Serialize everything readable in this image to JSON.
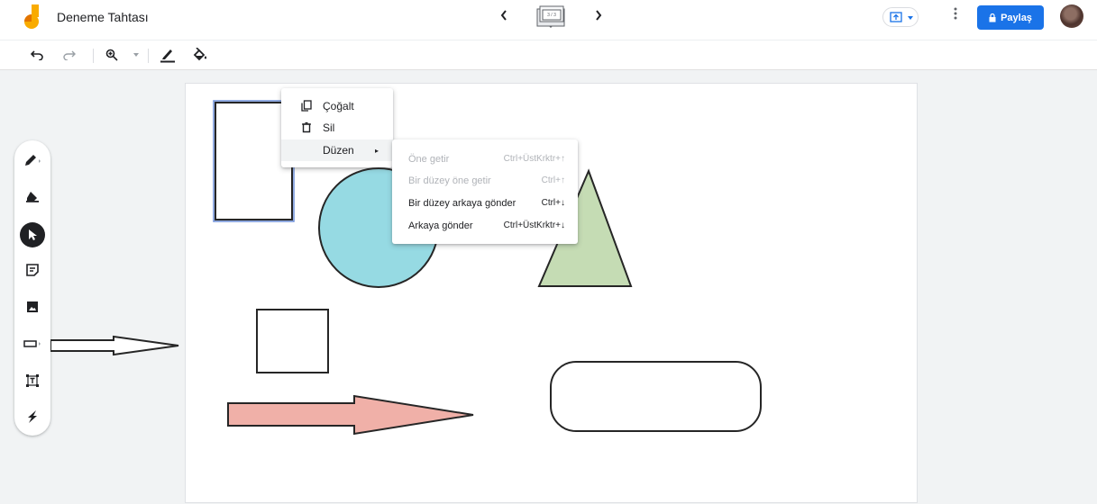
{
  "app": {
    "title": "Deneme Tahtası",
    "frame_counter": "3 / 3",
    "share_label": "Paylaş",
    "accent_color": "#1a73e8"
  },
  "icons": {
    "logo": "jamboard-logo-icon",
    "prev": "chevron-left-icon",
    "next": "chevron-right-icon",
    "present": "present-icon",
    "more": "more-vert-icon",
    "lock": "lock-icon",
    "undo": "undo-icon",
    "redo": "redo-icon",
    "zoom": "zoom-in-icon",
    "pen_color": "pen-color-icon",
    "fill": "fill-bucket-icon"
  },
  "side_tools": [
    {
      "name": "pen-tool",
      "icon": "pen-icon"
    },
    {
      "name": "eraser-tool",
      "icon": "eraser-icon"
    },
    {
      "name": "select-tool",
      "icon": "cursor-icon",
      "active": true
    },
    {
      "name": "sticky-note-tool",
      "icon": "sticky-note-icon"
    },
    {
      "name": "image-tool",
      "icon": "image-icon"
    },
    {
      "name": "shape-tool",
      "icon": "rectangle-icon"
    },
    {
      "name": "text-box-tool",
      "icon": "text-box-icon"
    },
    {
      "name": "laser-tool",
      "icon": "laser-icon"
    }
  ],
  "context_menu": {
    "items": [
      {
        "label": "Çoğalt",
        "icon": "duplicate-icon"
      },
      {
        "label": "Sil",
        "icon": "delete-icon"
      },
      {
        "label": "Düzen",
        "submenu_arrow": "▸"
      }
    ]
  },
  "arrange_submenu": {
    "items": [
      {
        "label": "Öne getir",
        "shortcut": "Ctrl+ÜstKrktr+↑",
        "enabled": false
      },
      {
        "label": "Bir düzey öne getir",
        "shortcut": "Ctrl+↑",
        "enabled": false
      },
      {
        "label": "Bir düzey arkaya gönder",
        "shortcut": "Ctrl+↓",
        "enabled": true
      },
      {
        "label": "Arkaya gönder",
        "shortcut": "Ctrl+ÜstKrktr+↓",
        "enabled": true
      }
    ]
  },
  "canvas_shapes": {
    "circle_fill": "#96dae3",
    "triangle_fill": "#c5dcb4",
    "arrow_fill": "#f0b0a8",
    "stroke": "#262626",
    "selection": "#6d8fd8"
  }
}
